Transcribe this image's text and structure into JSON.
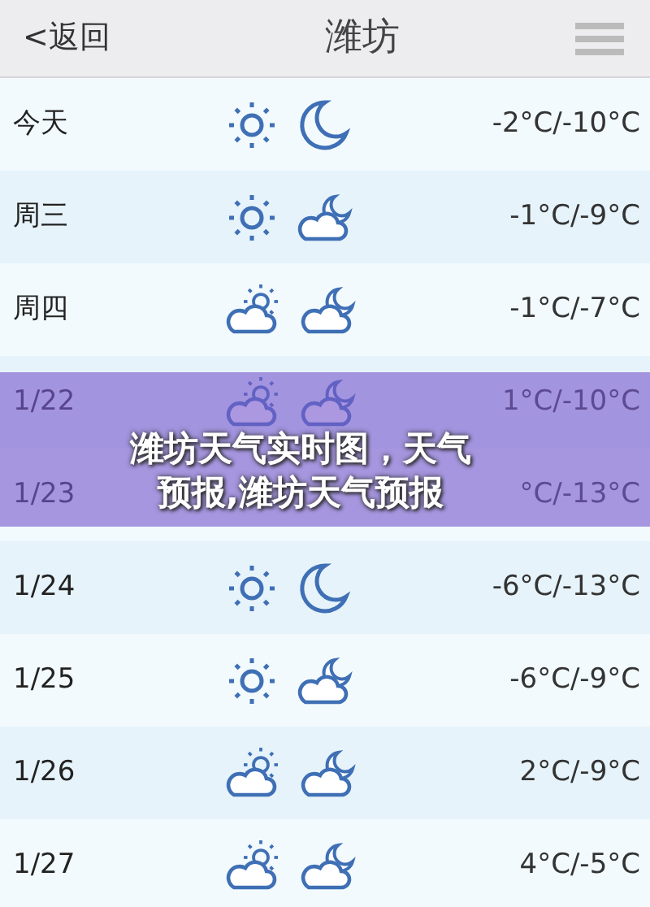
{
  "header": {
    "back": "<返回",
    "title": "潍坊"
  },
  "days": [
    {
      "day": "今天",
      "icons": [
        {
          "kind": "sun"
        },
        {
          "kind": "moon"
        }
      ],
      "temp": "-2°C/-10°C"
    },
    {
      "day": "周三",
      "icons": [
        {
          "kind": "sun"
        },
        {
          "kind": "cloud-moon"
        }
      ],
      "temp": "-1°C/-9°C"
    },
    {
      "day": "周四",
      "icons": [
        {
          "kind": "cloud-sun"
        },
        {
          "kind": "cloud-moon"
        }
      ],
      "temp": "-1°C/-7°C"
    },
    {
      "day": "1/22",
      "icons": [
        {
          "kind": "cloud-sun"
        },
        {
          "kind": "cloud-moon"
        }
      ],
      "temp": "1°C/-10°C"
    },
    {
      "day": "1/23",
      "temp": "°C/-13°C"
    },
    {
      "day": "1/24",
      "icons": [
        {
          "kind": "sun"
        },
        {
          "kind": "moon"
        }
      ],
      "temp": "-6°C/-13°C"
    },
    {
      "day": "1/25",
      "icons": [
        {
          "kind": "sun"
        },
        {
          "kind": "cloud-moon"
        }
      ],
      "temp": "-6°C/-9°C"
    },
    {
      "day": "1/26",
      "icons": [
        {
          "kind": "cloud-sun"
        },
        {
          "kind": "cloud-moon"
        }
      ],
      "temp": "2°C/-9°C"
    },
    {
      "day": "1/27",
      "icons": [
        {
          "kind": "cloud-sun"
        },
        {
          "kind": "cloud-moon"
        }
      ],
      "temp": "4°C/-5°C"
    }
  ],
  "banner": {
    "text": "潍坊天气实时图，天气预报,潍坊天气预报"
  }
}
